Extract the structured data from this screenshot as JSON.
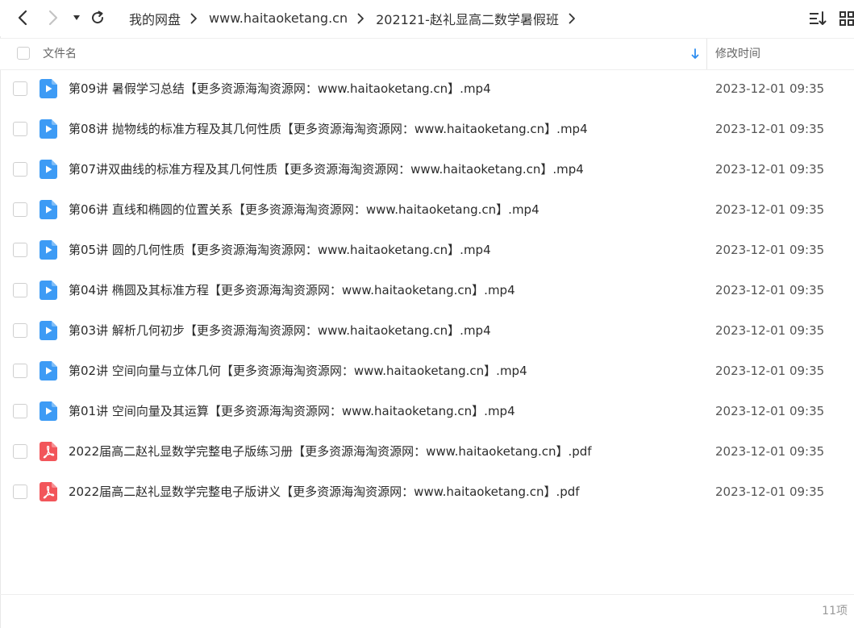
{
  "toolbar": {
    "back_icon": "chevron-left-icon",
    "forward_icon": "chevron-right-icon",
    "history_icon": "caret-down-icon",
    "refresh_icon": "refresh-icon",
    "sort_icon": "sort-list-icon",
    "view_icon": "grid-view-icon"
  },
  "breadcrumb": [
    "我的网盘",
    "www.haitaoketang.cn",
    "202121-赵礼显高二数学暑假班"
  ],
  "columns": {
    "name": "文件名",
    "modified": "修改时间"
  },
  "files": [
    {
      "name": "第09讲 暑假学习总结【更多资源海淘资源网：www.haitaoketang.cn】.mp4",
      "time": "2023-12-01 09:35",
      "type": "video"
    },
    {
      "name": "第08讲 抛物线的标准方程及其几何性质【更多资源海淘资源网：www.haitaoketang.cn】.mp4",
      "time": "2023-12-01 09:35",
      "type": "video"
    },
    {
      "name": "第07讲双曲线的标准方程及其几何性质【更多资源海淘资源网：www.haitaoketang.cn】.mp4",
      "time": "2023-12-01 09:35",
      "type": "video"
    },
    {
      "name": "第06讲 直线和椭圆的位置关系【更多资源海淘资源网：www.haitaoketang.cn】.mp4",
      "time": "2023-12-01 09:35",
      "type": "video"
    },
    {
      "name": "第05讲 圆的几何性质【更多资源海淘资源网：www.haitaoketang.cn】.mp4",
      "time": "2023-12-01 09:35",
      "type": "video"
    },
    {
      "name": "第04讲 椭圆及其标准方程【更多资源海淘资源网：www.haitaoketang.cn】.mp4",
      "time": "2023-12-01 09:35",
      "type": "video"
    },
    {
      "name": "第03讲 解析几何初步【更多资源海淘资源网：www.haitaoketang.cn】.mp4",
      "time": "2023-12-01 09:35",
      "type": "video"
    },
    {
      "name": "第02讲 空间向量与立体几何【更多资源海淘资源网：www.haitaoketang.cn】.mp4",
      "time": "2023-12-01 09:35",
      "type": "video"
    },
    {
      "name": "第01讲 空间向量及其运算【更多资源海淘资源网：www.haitaoketang.cn】.mp4",
      "time": "2023-12-01 09:35",
      "type": "video"
    },
    {
      "name": "2022届高二赵礼显数学完整电子版练习册【更多资源海淘资源网：www.haitaoketang.cn】.pdf",
      "time": "2023-12-01 09:35",
      "type": "pdf"
    },
    {
      "name": "2022届高二赵礼显数学完整电子版讲义【更多资源海淘资源网：www.haitaoketang.cn】.pdf",
      "time": "2023-12-01 09:35",
      "type": "pdf"
    }
  ],
  "footer": {
    "count": "11项"
  },
  "colors": {
    "video": "#3d9bf5",
    "pdf": "#f2555a",
    "sort_arrow": "#2f8ef0"
  }
}
